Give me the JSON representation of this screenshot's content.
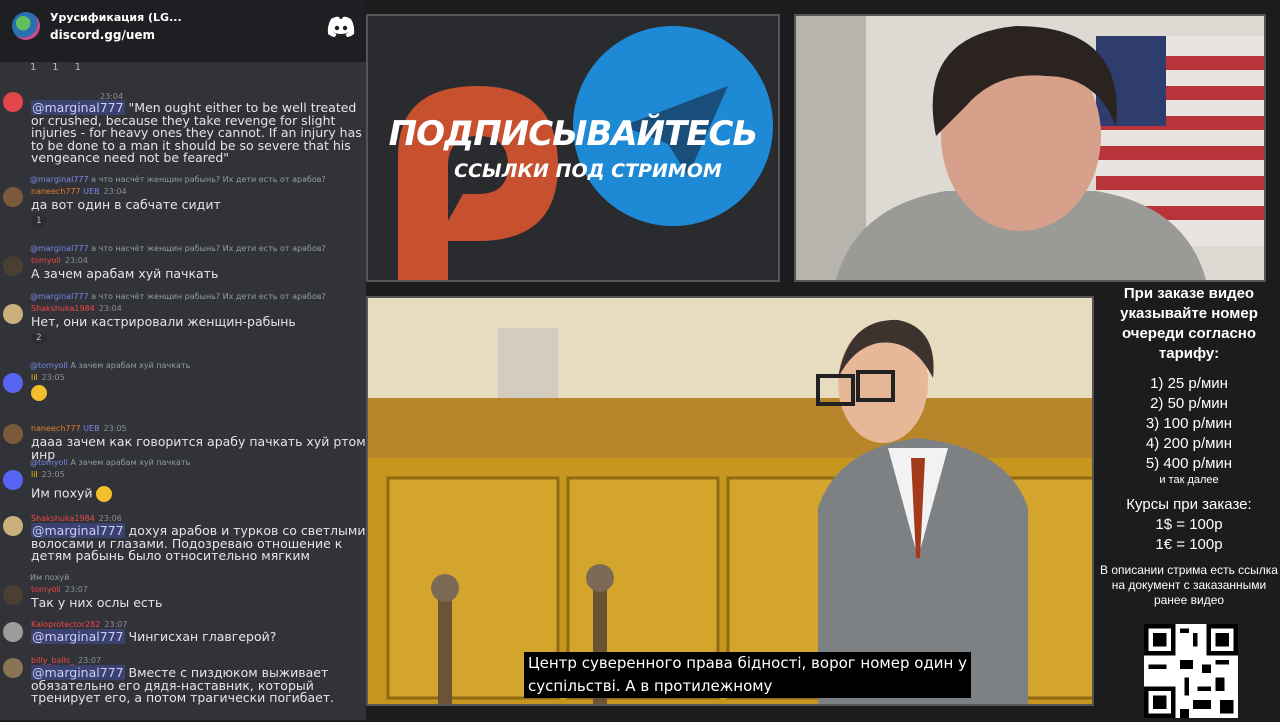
{
  "chat": {
    "server_name": "Урусификация (LG...",
    "server_link": "discord.gg/uem",
    "top_reactions": [
      "1",
      "1",
      "1"
    ],
    "messages": [
      {
        "time": "23:04",
        "body_mention": "@marginal777",
        "body": " \"Men ought either to be well treated or crushed, because they take revenge for slight injuries - for heavy ones they cannot. If an injury has to be done to a man it should be so severe that his vengeance need not be feared\""
      },
      {
        "reply_user": "@marginal777",
        "reply_text": "а что насчёт женщин рабынь? Их дети есть от арабов?",
        "user": "naneech777",
        "badge": "UEB",
        "time": "23:04",
        "body": "да вот один в сабчате сидит",
        "reaction": "1"
      },
      {
        "reply_user": "@marginal777",
        "reply_text": "а что насчёт женщин рабынь? Их дети есть от арабов?",
        "user": "tomyoll",
        "time": "23:04",
        "body": "А зачем арабам хуй пачкать"
      },
      {
        "reply_user": "@marginal777",
        "reply_text": "а что насчёт женщин рабынь? Их дети есть от арабов?",
        "user": "Shakshuka1984",
        "time": "23:04",
        "body": "Нет, они кастрировали женщин-рабынь",
        "reaction": "2"
      },
      {
        "reply_user": "@tomyoll",
        "reply_text": "А зачем арабам хуй пачкать",
        "user": "lil",
        "time": "23:05",
        "body": ""
      },
      {
        "user": "naneech777",
        "badge": "UEB",
        "time": "23:05",
        "body": "дааа зачем как говорится арабу пачкать хуй ртом инр"
      },
      {
        "reply_user": "@tomyoll",
        "reply_text": "А зачем арабам хуй пачкать",
        "user": "lil",
        "time": "23:05",
        "body": "Им похуй"
      },
      {
        "user": "Shakshuka1984",
        "time": "23:06",
        "body_mention": "@marginal777",
        "body": " дохуя арабов и турков со светлыми волосами и глазами. Подозреваю отношение к детям рабынь было относительно мягким"
      },
      {
        "reply_user": "",
        "reply_text": "Им похуй",
        "user": "tomyoll",
        "time": "23:07",
        "body": "Так у них ослы есть"
      },
      {
        "user": "Kaloprotector282",
        "time": "23:07",
        "body_mention": "@marginal777",
        "body": " Чингисхан главгерой?"
      },
      {
        "user": "billy_balls_",
        "time": "23:07",
        "body_mention": "@marginal777",
        "body": " Вместе с пиздюком выживает обязательно его дядя-наставник, который тренирует его, а потом трагически погибает."
      }
    ]
  },
  "promo": {
    "title": "ПОДПИСЫВАЙТЕСЬ",
    "subtitle": "ССЫЛКИ ПОД СТРИМОМ"
  },
  "game": {
    "subtitle_line1": "Центр суверенного права бідності, ворог номер один у",
    "subtitle_line2": "суспільстві. А в протилежному"
  },
  "info": {
    "intro": "При заказе видео указывайте номер очереди согласно тарифу:",
    "tariffs": [
      "1) 25 р/мин",
      "2) 50 р/мин",
      "3) 100 р/мин",
      "4) 200 р/мин",
      "5) 400 р/мин"
    ],
    "etc": "и так далее",
    "courses_title": "Курсы при заказе:",
    "course1": "1$ = 100р",
    "course2": "1€ = 100р",
    "description": "В описании стрима есть ссылка на документ с заказанными ранее видео"
  },
  "colors": {
    "discord_bg": "#313338",
    "mention_bg": "#3c4270",
    "discord_blurple": "#5865f2"
  }
}
